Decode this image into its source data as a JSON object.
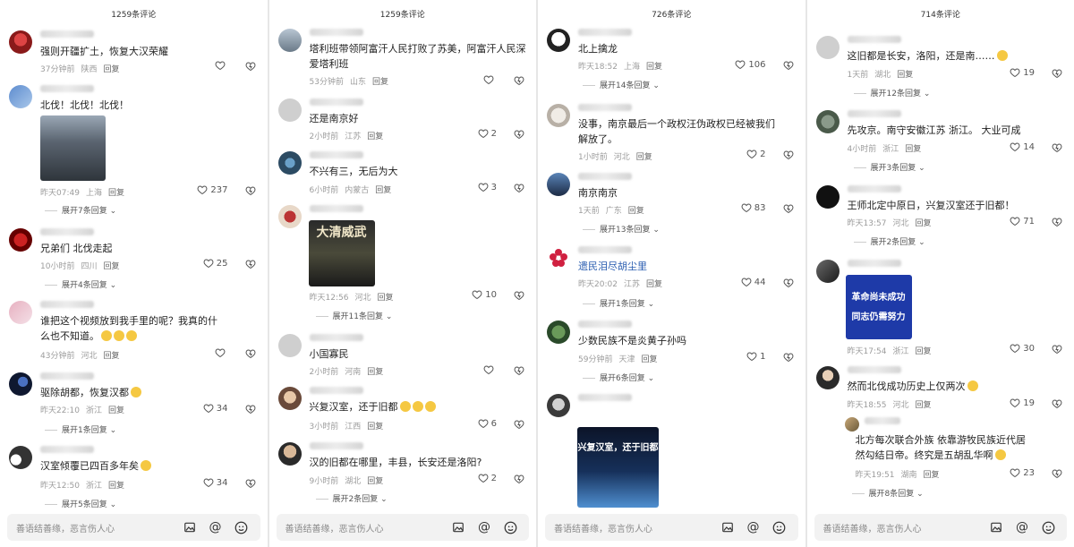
{
  "bottom_bar": {
    "placeholder": "善语结善缘，恶言伤人心",
    "icons": [
      "image-icon",
      "at-icon",
      "emoji-icon"
    ]
  },
  "panels": [
    {
      "count": "1259条评论",
      "comments": [
        {
          "text": "强则开疆扩土，恢复大汉荣耀",
          "time": "37分钟前",
          "loc": "陕西",
          "reply": "回复",
          "likes": ""
        },
        {
          "text": "北伐！北伐！北伐！",
          "time": "昨天07:49",
          "loc": "上海",
          "reply": "回复",
          "likes": "237",
          "expand": "展开7条回复"
        },
        {
          "text": "兄弟们 北伐走起",
          "time": "10小时前",
          "loc": "四川",
          "reply": "回复",
          "likes": "25",
          "expand": "展开4条回复"
        },
        {
          "text": "谁把这个视频放到我手里的呢？我真的什么也不知道。",
          "time": "43分钟前",
          "loc": "河北",
          "reply": "回复",
          "likes": ""
        },
        {
          "text": "驱除胡都，恢复汉都",
          "time": "昨天22:10",
          "loc": "浙江",
          "reply": "回复",
          "likes": "34",
          "expand": "展开1条回复"
        },
        {
          "text": "汉室倾覆已四百多年矣",
          "time": "昨天12:50",
          "loc": "浙江",
          "reply": "回复",
          "likes": "34",
          "expand": "展开5条回复"
        }
      ]
    },
    {
      "count": "1259条评论",
      "comments": [
        {
          "text": "塔利班带领阿富汗人民打败了苏美，阿富汗人民深爱塔利班",
          "time": "53分钟前",
          "loc": "山东",
          "reply": "回复",
          "likes": ""
        },
        {
          "text": "还是南京好",
          "time": "2小时前",
          "loc": "江苏",
          "reply": "回复",
          "likes": "2"
        },
        {
          "text": "不兴有三，无后为大",
          "time": "6小时前",
          "loc": "内蒙古",
          "reply": "回复",
          "likes": "3"
        },
        {
          "text": "",
          "time": "昨天12:56",
          "loc": "河北",
          "reply": "回复",
          "likes": "10",
          "expand": "展开11条回复",
          "image_text": "大清威武"
        },
        {
          "text": "小国寡民",
          "time": "2小时前",
          "loc": "河南",
          "reply": "回复",
          "likes": ""
        },
        {
          "text": "兴复汉室，还于旧都",
          "time": "3小时前",
          "loc": "江西",
          "reply": "回复",
          "likes": "6"
        },
        {
          "text": "汉的旧都在哪里，丰县，长安还是洛阳?",
          "time": "9小时前",
          "loc": "湖北",
          "reply": "回复",
          "likes": "2",
          "expand": "展开2条回复"
        }
      ]
    },
    {
      "count": "726条评论",
      "comments": [
        {
          "text": "北上擒龙",
          "time": "昨天18:52",
          "loc": "上海",
          "reply": "回复",
          "likes": "106",
          "expand": "展开14条回复"
        },
        {
          "text": "没事，南京最后一个政权汪伪政权已经被我们解放了。",
          "time": "1小时前",
          "loc": "河北",
          "reply": "回复",
          "likes": "2"
        },
        {
          "text": "南京南京",
          "time": "1天前",
          "loc": "广东",
          "reply": "回复",
          "likes": "83",
          "expand": "展开13条回复"
        },
        {
          "text": "遗民泪尽胡尘里",
          "time": "昨天20:02",
          "loc": "江苏",
          "reply": "回复",
          "likes": "44",
          "expand": "展开1条回复"
        },
        {
          "text": "少数民族不是炎黄子孙吗",
          "time": "59分钟前",
          "loc": "天津",
          "reply": "回复",
          "likes": "1",
          "expand": "展开6条回复"
        },
        {
          "text": "",
          "time": "",
          "loc": "",
          "reply": "",
          "likes": "",
          "image_text": "兴复汉室，还于旧都"
        }
      ]
    },
    {
      "count": "714条评论",
      "comments": [
        {
          "text": "这旧都是长安，洛阳，还是南……",
          "time": "1天前",
          "loc": "湖北",
          "reply": "回复",
          "likes": "19",
          "expand": "展开12条回复"
        },
        {
          "text": "先攻京。南守安徽江苏 浙江。 大业可成",
          "time": "4小时前",
          "loc": "浙江",
          "reply": "回复",
          "likes": "14",
          "expand": "展开3条回复"
        },
        {
          "text": "王师北定中原日，兴复汉室还于旧都！",
          "time": "昨天13:57",
          "loc": "河北",
          "reply": "回复",
          "likes": "71",
          "expand": "展开2条回复"
        },
        {
          "text": "",
          "time": "昨天17:54",
          "loc": "浙江",
          "reply": "回复",
          "likes": "30",
          "image_text": "革命尚未成功 同志仍需努力"
        },
        {
          "text": "然而北伐成功历史上仅两次",
          "time": "昨天18:55",
          "loc": "河北",
          "reply": "回复",
          "likes": "19"
        },
        {
          "text": "北方每次联合外族 依靠游牧民族近代居然勾结日帝。终究是五胡乱华啊",
          "time": "昨天19:51",
          "loc": "湖南",
          "reply": "回复",
          "likes": "23",
          "expand": "展开8条回复"
        }
      ]
    }
  ]
}
